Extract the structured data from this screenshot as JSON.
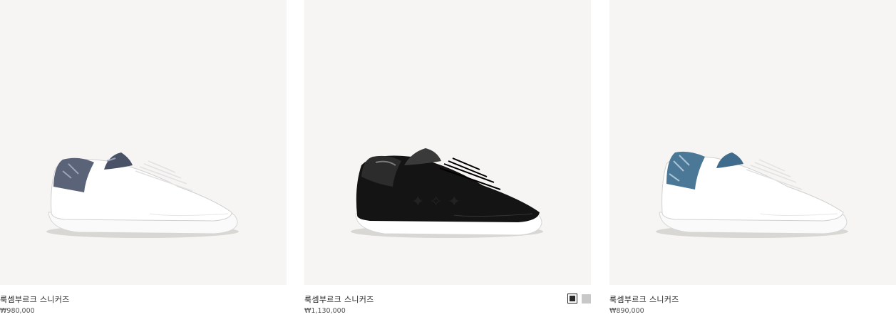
{
  "products": [
    {
      "name": "룩셈부르크 스니커즈",
      "price": "₩980,000",
      "heel_color": "#5a6378"
    },
    {
      "name": "룩셈부르크 스니커즈",
      "price": "₩1,130,000",
      "swatches": [
        "black-swatch",
        "grey-swatch"
      ]
    },
    {
      "name": "룩셈부르크 스니커즈",
      "price": "₩890,000",
      "heel_color": "#4b7896"
    }
  ]
}
